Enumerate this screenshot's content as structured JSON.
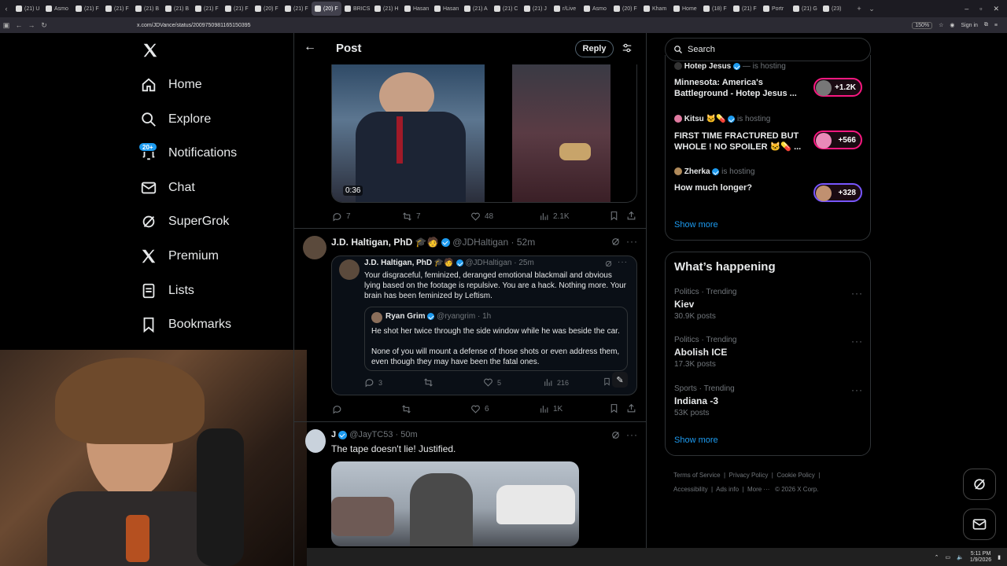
{
  "browser": {
    "tabs": [
      {
        "label": "(21) U"
      },
      {
        "label": "Asmo"
      },
      {
        "label": "(21) F"
      },
      {
        "label": "(21) F"
      },
      {
        "label": "(21) B"
      },
      {
        "label": "(21) B"
      },
      {
        "label": "(21) F"
      },
      {
        "label": "(21) F"
      },
      {
        "label": "(20) F"
      },
      {
        "label": "(21) F"
      },
      {
        "label": "(20) F"
      },
      {
        "label": "BRICS"
      },
      {
        "label": "(21) H"
      },
      {
        "label": "Hasan"
      },
      {
        "label": "Hasan"
      },
      {
        "label": "(21) A"
      },
      {
        "label": "(21) C"
      },
      {
        "label": "(21) J"
      },
      {
        "label": "r/Live"
      },
      {
        "label": "Asmo"
      },
      {
        "label": "(20) F"
      },
      {
        "label": "Kham"
      },
      {
        "label": "Home"
      },
      {
        "label": "(18) F"
      },
      {
        "label": "(21) F"
      },
      {
        "label": "Portr"
      },
      {
        "label": "(21) G"
      },
      {
        "label": "(23)"
      }
    ],
    "url": "x.com/JDVance/status/2009750981165150395",
    "zoom": "150%",
    "sign_in": "Sign in"
  },
  "nav": {
    "items": [
      {
        "label": "Home"
      },
      {
        "label": "Explore"
      },
      {
        "label": "Notifications"
      },
      {
        "label": "Chat"
      },
      {
        "label": "SuperGrok"
      },
      {
        "label": "Premium"
      },
      {
        "label": "Lists"
      },
      {
        "label": "Bookmarks"
      }
    ],
    "notif_badge": "20+"
  },
  "header": {
    "title": "Post",
    "reply_label": "Reply"
  },
  "post1": {
    "video_time": "0:36",
    "stats": {
      "replies": "7",
      "reposts": "7",
      "likes": "48",
      "views": "2.1K"
    }
  },
  "post2": {
    "name": "J.D. Haltigan, PhD",
    "handle": "@JDHaltigan",
    "time": "52m",
    "stats": {
      "replies": "",
      "reposts": "",
      "likes": "6",
      "views": "1K"
    },
    "quote": {
      "name": "J.D. Haltigan, PhD",
      "handle": "@JDHaltigan",
      "time": "25m",
      "text": "Your disgraceful, feminized, deranged emotional blackmail and obvious lying based on the footage is repulsive. You are a hack. Nothing more. Your brain has been feminized by Leftism.",
      "stats": {
        "replies": "3",
        "reposts": "",
        "likes": "5",
        "views": "216"
      },
      "inner": {
        "name": "Ryan Grim",
        "handle": "@ryangrim",
        "time": "1h",
        "text1": "He shot her twice through the side window while he was beside the car.",
        "text2": "None of you will mount a defense of those shots or even address them, even though they may have been the fatal ones."
      }
    }
  },
  "post3": {
    "name": "J",
    "handle": "@JayTC53",
    "time": "50m",
    "text": "The tape doesn't lie! Justified."
  },
  "search": {
    "placeholder": "Search"
  },
  "spaces": [
    {
      "host": "Hotep Jesus",
      "status": "is hosting",
      "title": "Minnesota: America's Battleground - Hotep Jesus ...",
      "count": "+1.2K"
    },
    {
      "host": "Kitsu",
      "status": "is hosting",
      "title": "FIRST TIME FRACTURED BUT WHOLE ! NO SPOILER",
      "count": "+566"
    },
    {
      "host": "Zherka",
      "status": "is hosting",
      "title": "How much longer?",
      "count": "+328"
    }
  ],
  "spaces_show_more": "Show more",
  "happening": {
    "title": "What’s happening",
    "trends": [
      {
        "meta": "Politics · Trending",
        "name": "Kiev",
        "posts": "30.9K posts"
      },
      {
        "meta": "Politics · Trending",
        "name": "Abolish ICE",
        "posts": "17.3K posts"
      },
      {
        "meta": "Sports · Trending",
        "name": "Indiana -3",
        "posts": "53K posts"
      }
    ],
    "show_more": "Show more"
  },
  "footer": {
    "links": [
      "Terms of Service",
      "Privacy Policy",
      "Cookie Policy",
      "Accessibility",
      "Ads info",
      "More ···"
    ],
    "copyright": "© 2026 X Corp."
  },
  "taskbar": {
    "time": "5:11 PM",
    "date": "1/9/2026"
  }
}
